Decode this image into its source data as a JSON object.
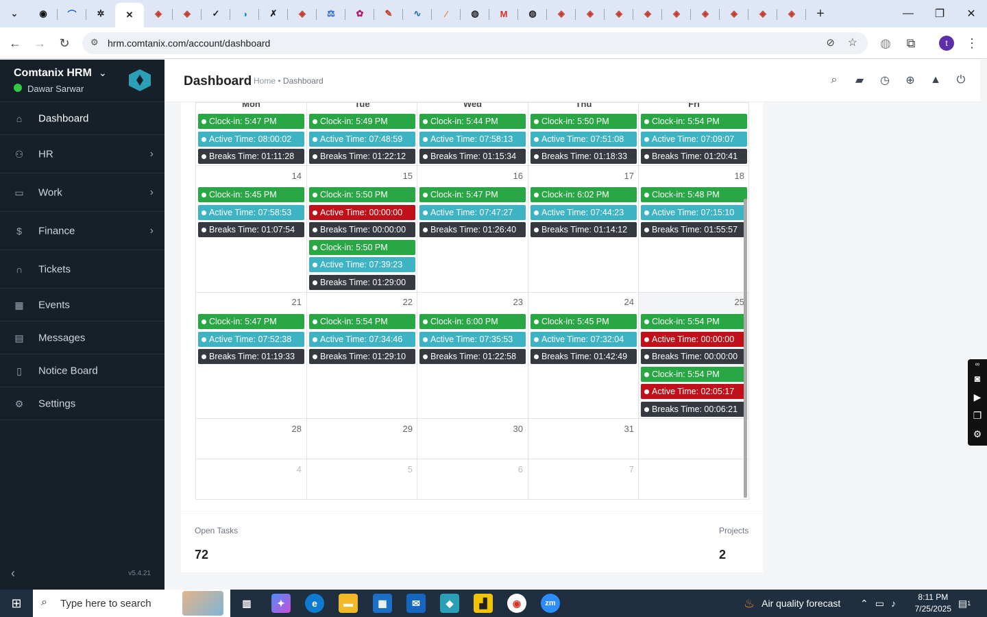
{
  "browser": {
    "url": "hrm.comtanix.com/account/dashboard",
    "new_tab": "+",
    "window_controls": [
      "minimize",
      "restore",
      "close"
    ]
  },
  "sidebar": {
    "brand": "Comtanix HRM",
    "user": "Dawar Sarwar",
    "items": [
      {
        "label": "Dashboard",
        "icon": "home-icon"
      },
      {
        "label": "HR",
        "icon": "users-icon"
      },
      {
        "label": "Work",
        "icon": "briefcase-icon"
      },
      {
        "label": "Finance",
        "icon": "dollar-icon"
      },
      {
        "label": "Tickets",
        "icon": "headset-icon"
      },
      {
        "label": "Events",
        "icon": "calendar-icon"
      },
      {
        "label": "Messages",
        "icon": "chat-icon"
      },
      {
        "label": "Notice Board",
        "icon": "clipboard-icon"
      },
      {
        "label": "Settings",
        "icon": "gear-icon"
      }
    ],
    "version": "v5.4.21"
  },
  "header": {
    "title": "Dashboard",
    "crumb_home": "Home",
    "crumb_sep": "•",
    "crumb_current": "Dashboard"
  },
  "calendar": {
    "days": [
      "Mon",
      "Tue",
      "Wed",
      "Thu",
      "Fri"
    ],
    "week1": {
      "mon": [
        "Clock-in: 5:47 PM",
        "Active Time: 08:00:02",
        "Breaks Time: 01:11:28"
      ],
      "tue": [
        "Clock-in: 5:49 PM",
        "Active Time: 07:48:59",
        "Breaks Time: 01:22:12"
      ],
      "wed": [
        "Clock-in: 5:44 PM",
        "Active Time: 07:58:13",
        "Breaks Time: 01:15:34"
      ],
      "thu": [
        "Clock-in: 5:50 PM",
        "Active Time: 07:51:08",
        "Breaks Time: 01:18:33"
      ],
      "fri": [
        "Clock-in: 5:54 PM",
        "Active Time: 07:09:07",
        "Breaks Time: 01:20:41"
      ]
    },
    "week2": {
      "nums": [
        "14",
        "15",
        "16",
        "17",
        "18"
      ],
      "mon": [
        "Clock-in: 5:45 PM",
        "Active Time: 07:58:53",
        "Breaks Time: 01:07:54"
      ],
      "tue": [
        "Clock-in: 5:50 PM",
        "Active Time: 00:00:00",
        "Breaks Time: 00:00:00",
        "Clock-in: 5:50 PM",
        "Active Time: 07:39:23",
        "Breaks Time: 01:29:00"
      ],
      "wed": [
        "Clock-in: 5:47 PM",
        "Active Time: 07:47:27",
        "Breaks Time: 01:26:40"
      ],
      "thu": [
        "Clock-in: 6:02 PM",
        "Active Time: 07:44:23",
        "Breaks Time: 01:14:12"
      ],
      "fri": [
        "Clock-in: 5:48 PM",
        "Active Time: 07:15:10",
        "Breaks Time: 01:55:57"
      ]
    },
    "week3": {
      "nums": [
        "21",
        "22",
        "23",
        "24",
        "25"
      ],
      "mon": [
        "Clock-in: 5:47 PM",
        "Active Time: 07:52:38",
        "Breaks Time: 01:19:33"
      ],
      "tue": [
        "Clock-in: 5:54 PM",
        "Active Time: 07:34:46",
        "Breaks Time: 01:29:10"
      ],
      "wed": [
        "Clock-in: 6:00 PM",
        "Active Time: 07:35:53",
        "Breaks Time: 01:22:58"
      ],
      "thu": [
        "Clock-in: 5:45 PM",
        "Active Time: 07:32:04",
        "Breaks Time: 01:42:49"
      ],
      "fri": [
        "Clock-in: 5:54 PM",
        "Active Time: 00:00:00",
        "Breaks Time: 00:00:00",
        "Clock-in: 5:54 PM",
        "Active Time: 02:05:17",
        "Breaks Time: 00:06:21"
      ]
    },
    "week4": {
      "nums": [
        "28",
        "29",
        "30",
        "31",
        ""
      ]
    },
    "week5": {
      "nums": [
        "4",
        "5",
        "6",
        "7",
        ""
      ]
    }
  },
  "stats": {
    "open_tasks_label": "Open Tasks",
    "open_tasks_value": "72",
    "projects_label": "Projects",
    "projects_value": "2"
  },
  "taskbar": {
    "search_placeholder": "Type here to search",
    "weather": "Air quality forecast",
    "time": "8:11 PM",
    "date": "7/25/2025",
    "notif_count": "1"
  },
  "colors": {
    "sidebar_bg": "#171f29",
    "clockin": "#29a745",
    "active": "#3eb3c4",
    "active_zero": "#c0111a",
    "breaks": "#343a40"
  }
}
